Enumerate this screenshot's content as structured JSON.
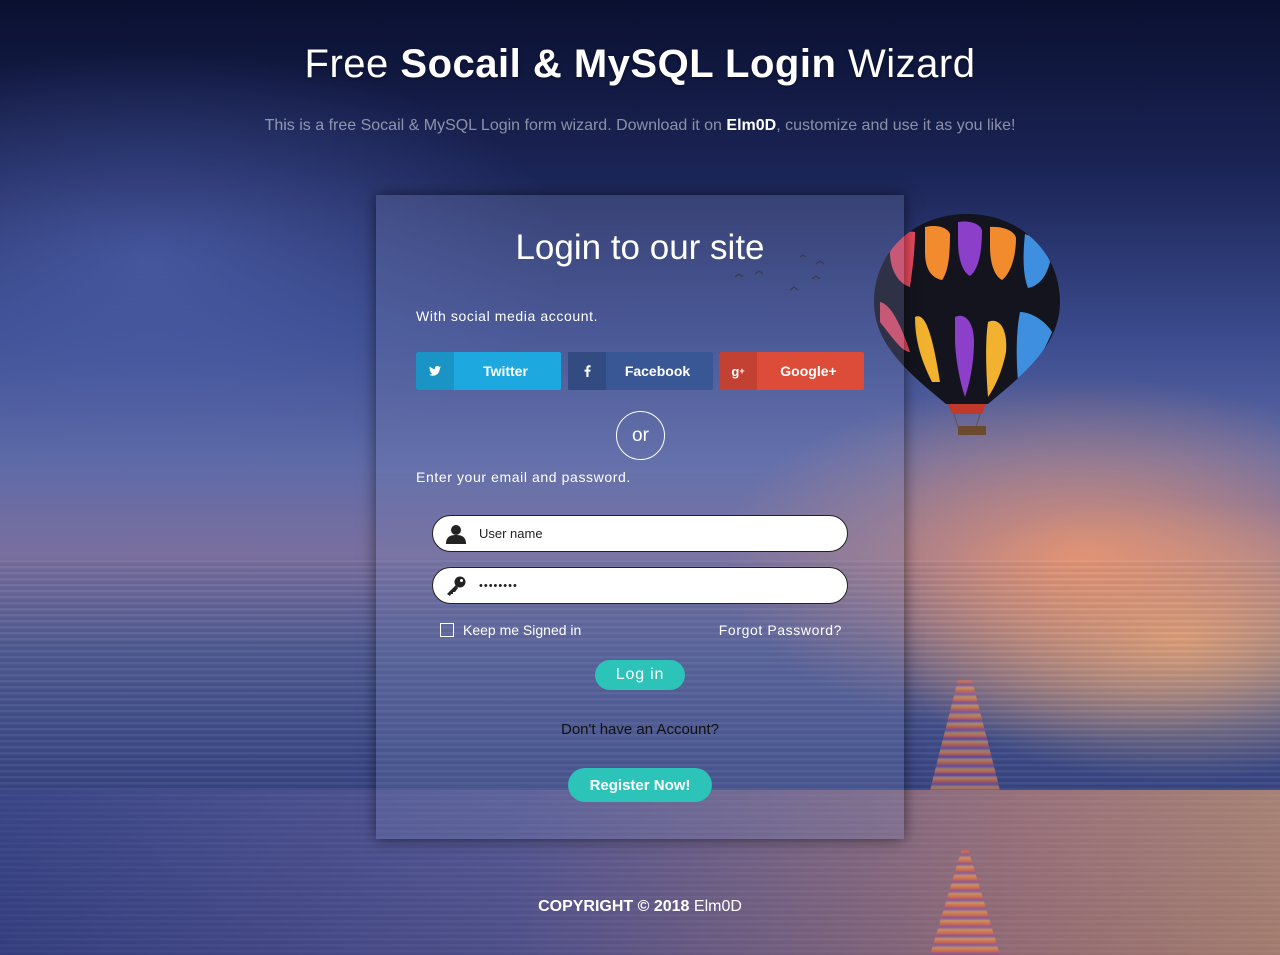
{
  "header": {
    "title_prefix": "Free",
    "title_bold": "Socail & MySQL Login",
    "title_suffix": "Wizard",
    "subtitle_prefix": "This is a free Socail & MySQL Login form wizard. Download it on",
    "subtitle_link": "Elm0D",
    "subtitle_suffix": ", customize and use it as you like!"
  },
  "login": {
    "title": "Login to our site",
    "social_label": "With social media account.",
    "social_buttons": [
      {
        "label": "Twitter",
        "icon": "twitter-icon",
        "color": "#1da9e0"
      },
      {
        "label": "Facebook",
        "icon": "facebook-icon",
        "color": "#3a5795"
      },
      {
        "label": "Google+",
        "icon": "google-plus-icon",
        "color": "#dd4b39"
      }
    ],
    "or_label": "or",
    "email_label": "Enter your email and password.",
    "username_placeholder": "User name",
    "password_value": "••••••••",
    "remember_label": "Keep me Signed in",
    "forgot_label": "Forgot Password?",
    "login_button": "Log in",
    "no_account_text": "Don't have an Account?",
    "register_button": "Register Now!"
  },
  "footer": {
    "copyright_bold": "COPYRIGHT © 2018",
    "copyright_name": "Elm0D"
  },
  "colors": {
    "accent": "#2cc3b9",
    "twitter": "#1da9e0",
    "facebook": "#3a5795",
    "google": "#dd4b39"
  }
}
